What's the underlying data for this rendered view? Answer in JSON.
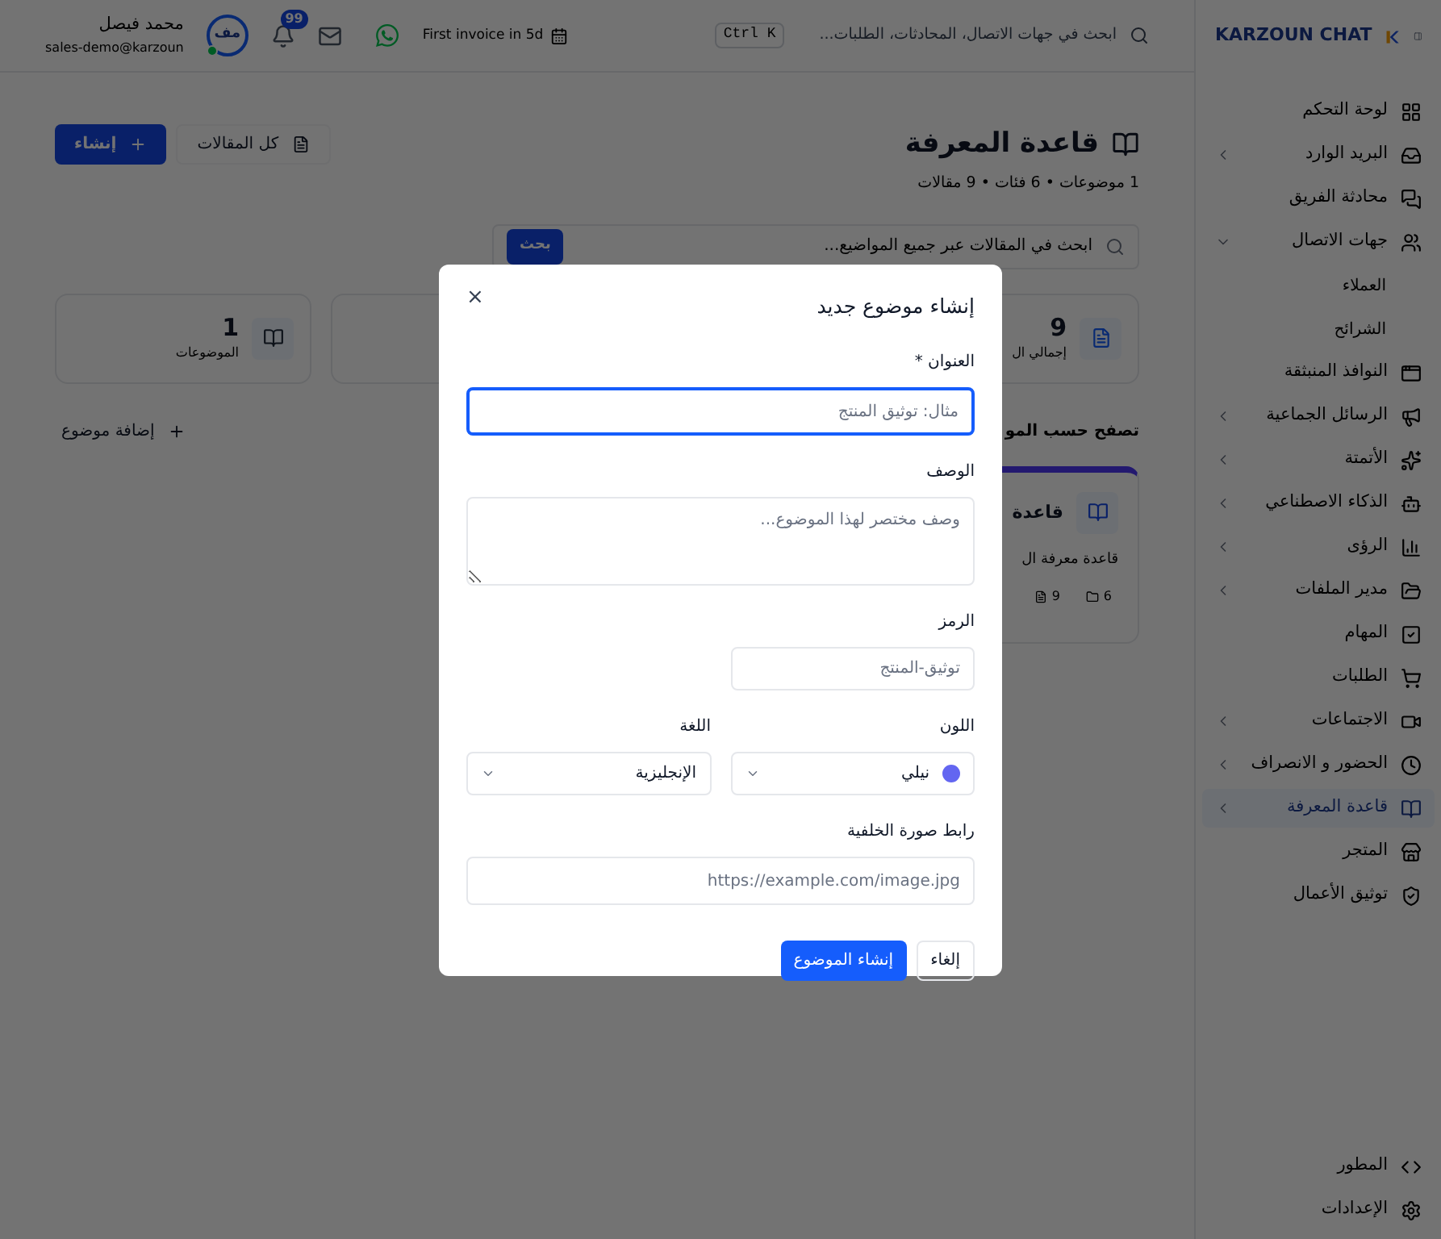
{
  "sidebar": {
    "logo": "KARZOUN CHAT",
    "items": [
      {
        "label": "لوحة التحكم",
        "kind": "link",
        "selected": false
      },
      {
        "label": "البريد الوارد",
        "kind": "group",
        "expanded": false,
        "selected": false
      },
      {
        "label": "محادثة الفريق",
        "kind": "link",
        "selected": false
      },
      {
        "label": "جهات الاتصال",
        "kind": "group",
        "expanded": true,
        "selected": false,
        "children": [
          {
            "label": "العملاء",
            "selected": false
          },
          {
            "label": "الشرائح",
            "selected": false
          }
        ]
      },
      {
        "label": "النوافذ المنبثقة",
        "kind": "link",
        "selected": false
      },
      {
        "label": "الرسائل الجماعية",
        "kind": "group",
        "expanded": false,
        "selected": false
      },
      {
        "label": "الأتمتة",
        "kind": "group",
        "expanded": false,
        "selected": false
      },
      {
        "label": "الذكاء الاصطناعي",
        "kind": "group",
        "expanded": false,
        "selected": false
      },
      {
        "label": "الرؤى",
        "kind": "group",
        "expanded": false,
        "selected": false
      },
      {
        "label": "مدير الملفات",
        "kind": "group",
        "expanded": false,
        "selected": false
      },
      {
        "label": "المهام",
        "kind": "link",
        "selected": false
      },
      {
        "label": "الطلبات",
        "kind": "link",
        "selected": false
      },
      {
        "label": "الاجتماعات",
        "kind": "group",
        "expanded": false,
        "selected": false
      },
      {
        "label": "الحضور و الانصراف",
        "kind": "group",
        "expanded": false,
        "selected": false
      },
      {
        "label": "قاعدة المعرفة",
        "kind": "group",
        "expanded": false,
        "selected": true
      },
      {
        "label": "المتجر",
        "kind": "link",
        "selected": false
      },
      {
        "label": "توثيق الأعمال",
        "kind": "link",
        "selected": false
      }
    ],
    "footer_items": [
      {
        "label": "المطور"
      },
      {
        "label": "الإعدادات"
      }
    ]
  },
  "topbar": {
    "search": {
      "placeholder": "ابحث في جهات الاتصال، المحادثات، الطلبات..."
    },
    "shortcut": "Ctrl K",
    "trial_badge": "First invoice in 5d",
    "notifications_count": "99",
    "user": {
      "initials": "مف",
      "name": "محمد فيصل",
      "email": "sales-demo@karzoun",
      "online": true
    }
  },
  "page": {
    "title": "قاعدة المعرفة",
    "subtitle": "1 موضوعات • 6 فئات • 9 مقالات",
    "actions": [
      {
        "label": "كل المقالات",
        "kind": "outline"
      },
      {
        "label": "إنشاء",
        "kind": "primary"
      }
    ],
    "search": {
      "placeholder": "ابحث في المقالات عبر جميع المواضيع...",
      "button": "بحث"
    },
    "stats": [
      {
        "value": "9",
        "label": "إجمالي ال"
      },
      {
        "value": "1",
        "label": "الموضوعات"
      }
    ],
    "browse": {
      "title": "تصفح حسب المو",
      "add_button": "إضافة موضوع",
      "topics": [
        {
          "name": "قاعدة",
          "description": "قاعدة معرفة ال",
          "categories": "6",
          "articles": "9"
        }
      ]
    }
  },
  "dialog": {
    "title": "إنشاء موضوع جديد",
    "close": "×",
    "fields": [
      {
        "kind": "text",
        "label": "العنوان *",
        "placeholder": "مثال: توثيق المنتج",
        "focused": true
      },
      {
        "kind": "textarea",
        "label": "الوصف",
        "placeholder": "وصف مختصر لهذا الموضوع...",
        "focused": false
      },
      {
        "kind": "short",
        "label": "الرمز",
        "placeholder": "توثيق-المنتج",
        "focused": false
      },
      {
        "kind": "select",
        "label": "اللون",
        "value": "نيلي",
        "color": "#6366f1",
        "focused": false
      },
      {
        "kind": "select",
        "label": "اللغة",
        "value": "الإنجليزية",
        "focused": false
      },
      {
        "kind": "text",
        "label": "رابط صورة الخلفية",
        "placeholder": "https://example.com/image.jpg",
        "focused": false
      }
    ],
    "buttons": [
      {
        "label": "إلغاء",
        "kind": "secondary"
      },
      {
        "label": "إنشاء الموضوع",
        "kind": "primary"
      }
    ]
  }
}
